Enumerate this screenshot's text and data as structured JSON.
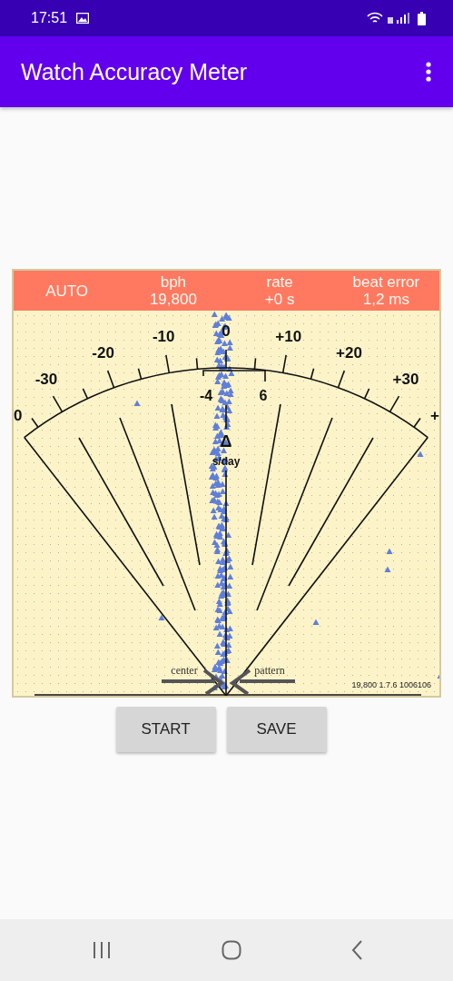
{
  "status_bar": {
    "time": "17:51"
  },
  "app_bar": {
    "title": "Watch Accuracy Meter"
  },
  "meter": {
    "header": [
      {
        "kind": "single",
        "value": "AUTO"
      },
      {
        "kind": "pair",
        "label": "bph",
        "value": "19,800"
      },
      {
        "kind": "pair",
        "label": "rate",
        "value": "+0 s"
      },
      {
        "kind": "pair",
        "label": "beat error",
        "value": "1,2 ms"
      }
    ],
    "scale_labels": [
      "0",
      "-30",
      "-20",
      "-10",
      "0",
      "+10",
      "+20",
      "+30",
      "+"
    ],
    "bracket": {
      "low": "-4",
      "high": "6"
    },
    "delta_symbol": "Δ",
    "unit": "s/day",
    "center_label": "center",
    "pattern_label": "pattern",
    "version": "19,800 1.7.6 1006106"
  },
  "buttons": [
    "START",
    "SAVE"
  ]
}
